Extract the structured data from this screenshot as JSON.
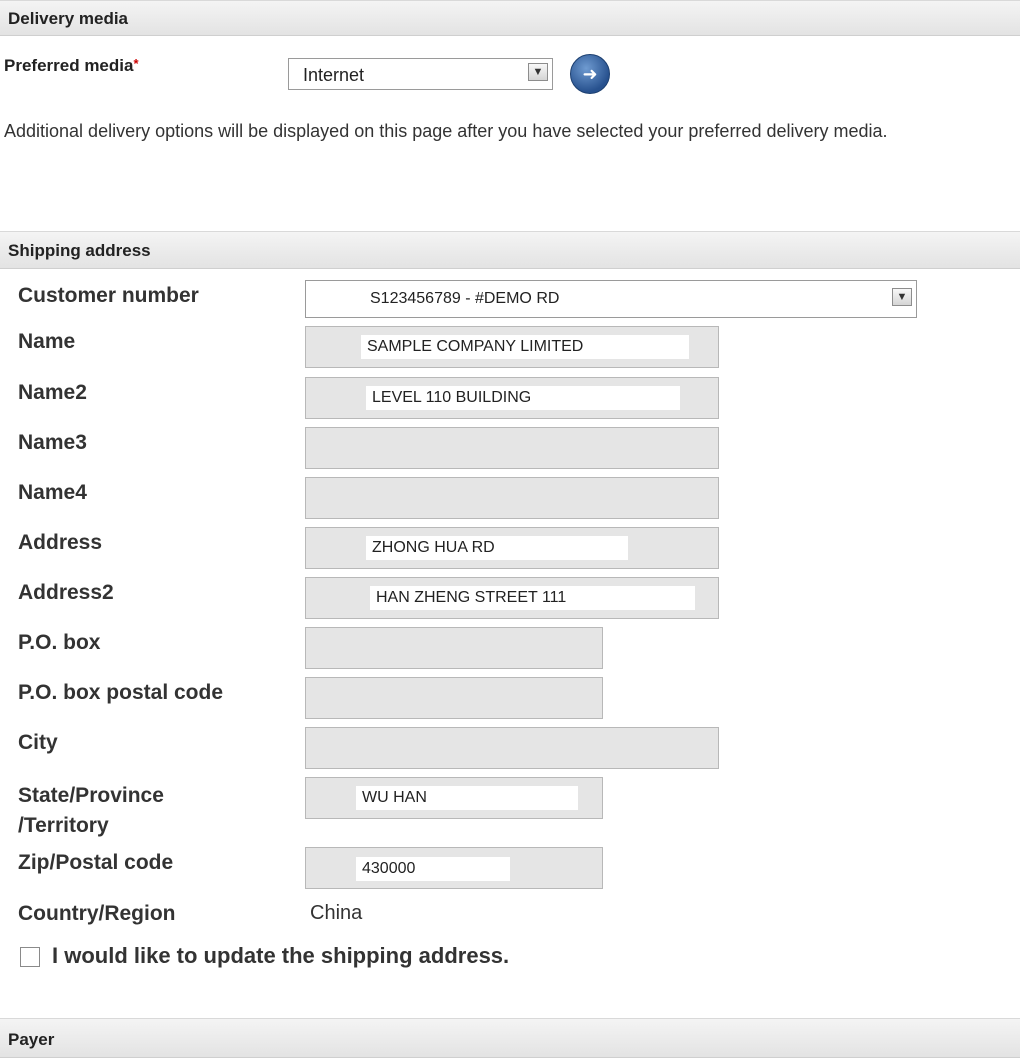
{
  "delivery_media": {
    "header": "Delivery media",
    "preferred_label": "Preferred media",
    "required_mark": "*",
    "selected": "Internet",
    "info": "Additional delivery options will be displayed on this page after you have selected your preferred delivery media."
  },
  "shipping_address": {
    "header": "Shipping address",
    "customer_number_label": "Customer number",
    "customer_number_value": "S123456789 - #DEMO RD",
    "fields": {
      "name": {
        "label": "Name",
        "value": "SAMPLE COMPANY LIMITED"
      },
      "name2": {
        "label": "Name2",
        "value": "LEVEL 110 BUILDING"
      },
      "name3": {
        "label": "Name3",
        "value": ""
      },
      "name4": {
        "label": "Name4",
        "value": ""
      },
      "address": {
        "label": "Address",
        "value": "ZHONG HUA RD"
      },
      "address2": {
        "label": "Address2",
        "value": "HAN ZHENG STREET 111"
      },
      "po_box": {
        "label": "P.O. box",
        "value": ""
      },
      "po_box_postal": {
        "label": "P.O. box postal code",
        "value": ""
      },
      "city": {
        "label": "City",
        "value": ""
      },
      "state_line1": {
        "label": "State/Province",
        "value": "WU HAN"
      },
      "state_line2": {
        "label": "/Territory"
      },
      "zip": {
        "label": "Zip/Postal code",
        "value": "430000"
      }
    },
    "country_label": "Country/Region",
    "country_value": "China",
    "update_checkbox_label": "I would like to update the shipping address."
  },
  "payer": {
    "header": "Payer"
  },
  "icons": {
    "go": "arrow-right-icon",
    "dropdown": "chevron-down-icon"
  }
}
